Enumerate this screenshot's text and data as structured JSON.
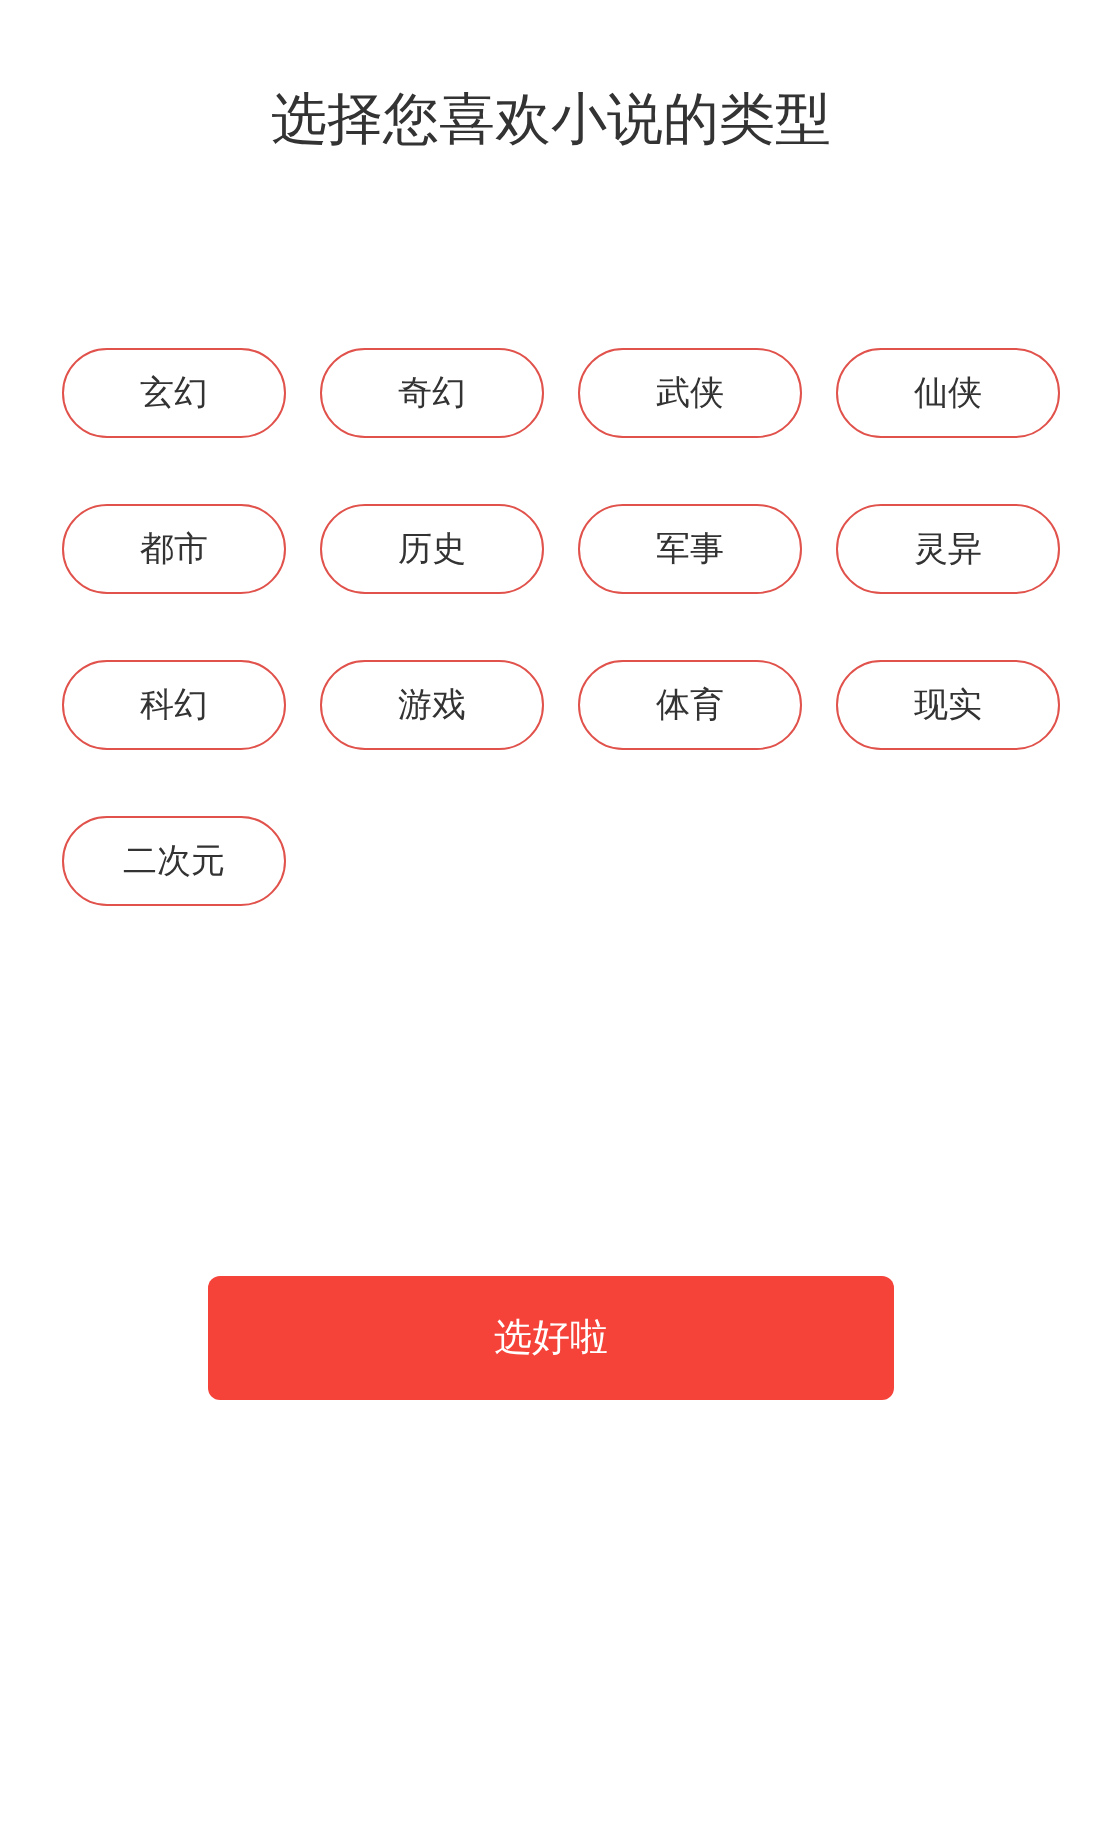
{
  "title": "选择您喜欢小说的类型",
  "genres": [
    "玄幻",
    "奇幻",
    "武侠",
    "仙侠",
    "都市",
    "历史",
    "军事",
    "灵异",
    "科幻",
    "游戏",
    "体育",
    "现实",
    "二次元"
  ],
  "confirm_button": "选好啦"
}
